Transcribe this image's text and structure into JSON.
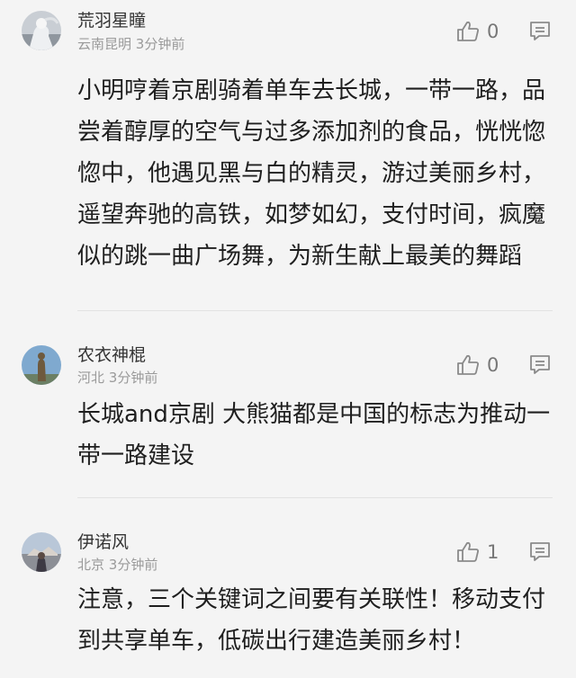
{
  "comments": [
    {
      "username": "荒羽星瞳",
      "location": "云南昆明",
      "time": "3分钟前",
      "likes": "0",
      "content": "小明哼着京剧骑着单车去长城，一带一路，品尝着醇厚的空气与过多添加剂的食品，恍恍惚惚中，他遇见黑与白的精灵，游过美丽乡村，遥望奔驰的高铁，如梦如幻，支付时间，疯魔似的跳一曲广场舞，为新生献上最美的舞蹈"
    },
    {
      "username": "农衣神棍",
      "location": "河北",
      "time": "3分钟前",
      "likes": "0",
      "content": "长城and京剧 大熊猫都是中国的标志为推动一带一路建设"
    },
    {
      "username": "伊诺风",
      "location": "北京",
      "time": "3分钟前",
      "likes": "1",
      "content": "注意，三个关键词之间要有关联性！移动支付到共享单车，低碳出行建造美丽乡村！"
    }
  ],
  "icons": {
    "like": "thumbs-up-icon",
    "reply": "comment-bubble-icon"
  },
  "colors": {
    "background": "#f4f4f4",
    "text": "#1f1f1f",
    "meta": "#9a9a9a",
    "icon": "#8a8a8a"
  }
}
